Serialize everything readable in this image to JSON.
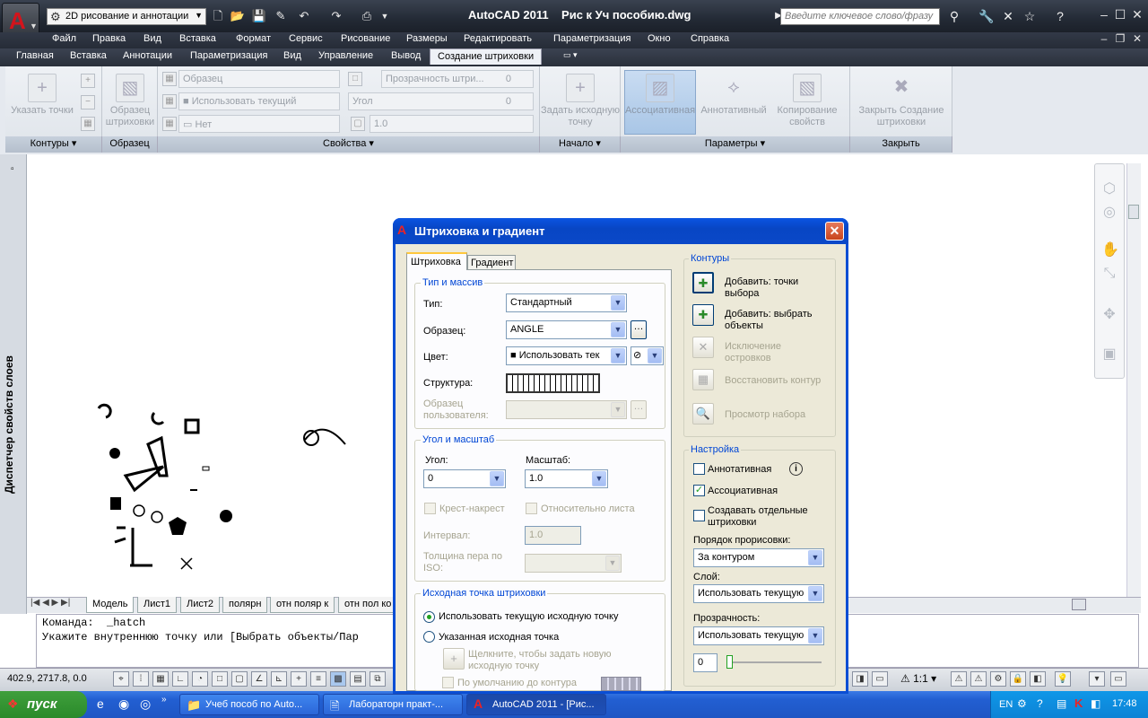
{
  "app": {
    "title": "AutoCAD 2011    Рис к Уч пособию.dwg",
    "workspace": "2D рисование и аннотации",
    "search_placeholder": "Введите ключевое слово/фразу"
  },
  "menu": [
    "Файл",
    "Правка",
    "Вид",
    "Вставка",
    "Формат",
    "Сервис",
    "Рисование",
    "Размеры",
    "Редактировать",
    "Параметризация",
    "Окно",
    "Справка"
  ],
  "ribbon_tabs": [
    "Главная",
    "Вставка",
    "Аннотации",
    "Параметризация",
    "Вид",
    "Управление",
    "Вывод",
    "Создание штриховки"
  ],
  "ribbon": {
    "pick_points": "Указать точки",
    "pattern_btn": "Образец штриховки",
    "combo_pattern": "Образец",
    "combo_use_current": "Использовать текущий",
    "combo_none": "Нет",
    "transparency": "Прозрачность штри...",
    "transparency_val": "0",
    "angle": "Угол",
    "angle_val": "0",
    "scale_val": "1.0",
    "set_origin": "Задать исходную точку",
    "associative": "Ассоциативная",
    "annotative": "Аннотативный",
    "copy_props": "Копирование свойств",
    "close_btn": "Закрыть Создание штриховки",
    "panels": {
      "contours": "Контуры",
      "pattern": "Образец",
      "properties": "Свойства",
      "origin": "Начало",
      "params": "Параметры",
      "close": "Закрыть"
    }
  },
  "palette_title": "Диспетчер свойств слоев",
  "layout_tabs": [
    "Модель",
    "Лист1",
    "Лист2",
    "полярн",
    "отн поляр к",
    "отн пол ко"
  ],
  "command": {
    "line1": "Команда:  _hatch",
    "line2": "Укажите внутреннюю точку или [Выбрать объекты/Пар"
  },
  "status": {
    "coords": "402.9, 2717.8, 0.0",
    "scale": "1:1"
  },
  "taskbar": {
    "start": "пуск",
    "items": [
      "Учеб пособ по Auto...",
      "Лабораторн практ-...",
      "AutoCAD 2011 - [Рис..."
    ],
    "lang": "EN",
    "time": "17:48"
  },
  "dialog": {
    "title": "Штриховка и градиент",
    "tabs": [
      "Штриховка",
      "Градиент"
    ],
    "type_group": "Тип и массив",
    "type_label": "Тип:",
    "type_value": "Стандартный",
    "pattern_label": "Образец:",
    "pattern_value": "ANGLE",
    "color_label": "Цвет:",
    "color_value": "Использовать тек",
    "swatch_label": "Структура:",
    "custom_label": "Образец пользователя:",
    "angle_group": "Угол и масштаб",
    "angle_label": "Угол:",
    "angle_value": "0",
    "scale_label": "Масштаб:",
    "scale_value": "1.0",
    "double": "Крест-накрест",
    "relative": "Относительно листа",
    "spacing_label": "Интервал:",
    "spacing_value": "1.0",
    "iso_label": "Толщина пера по ISO:",
    "origin_group": "Исходная точка штриховки",
    "use_current_origin": "Использовать текущую исходную точку",
    "specified_origin": "Указанная исходная точка",
    "click_set": "Щелкните, чтобы задать новую исходную точку",
    "default_extents": "По умолчанию до контура",
    "boundaries_group": "Контуры",
    "add_pick": "Добавить: точки выбора",
    "add_select": "Добавить: выбрать объекты",
    "remove_islands": "Исключение островков",
    "recreate": "Восстановить контур",
    "view_sel": "Просмотр набора",
    "options_group": "Настройка",
    "annotative": "Аннотативная",
    "associative": "Ассоциативная",
    "separate": "Создавать отдельные штриховки",
    "draw_order_label": "Порядок прорисовки:",
    "draw_order": "За контуром",
    "layer_label": "Слой:",
    "layer": "Использовать текущую",
    "transp_label": "Прозрачность:",
    "transp": "Использовать текущую",
    "transp_val": "0"
  }
}
